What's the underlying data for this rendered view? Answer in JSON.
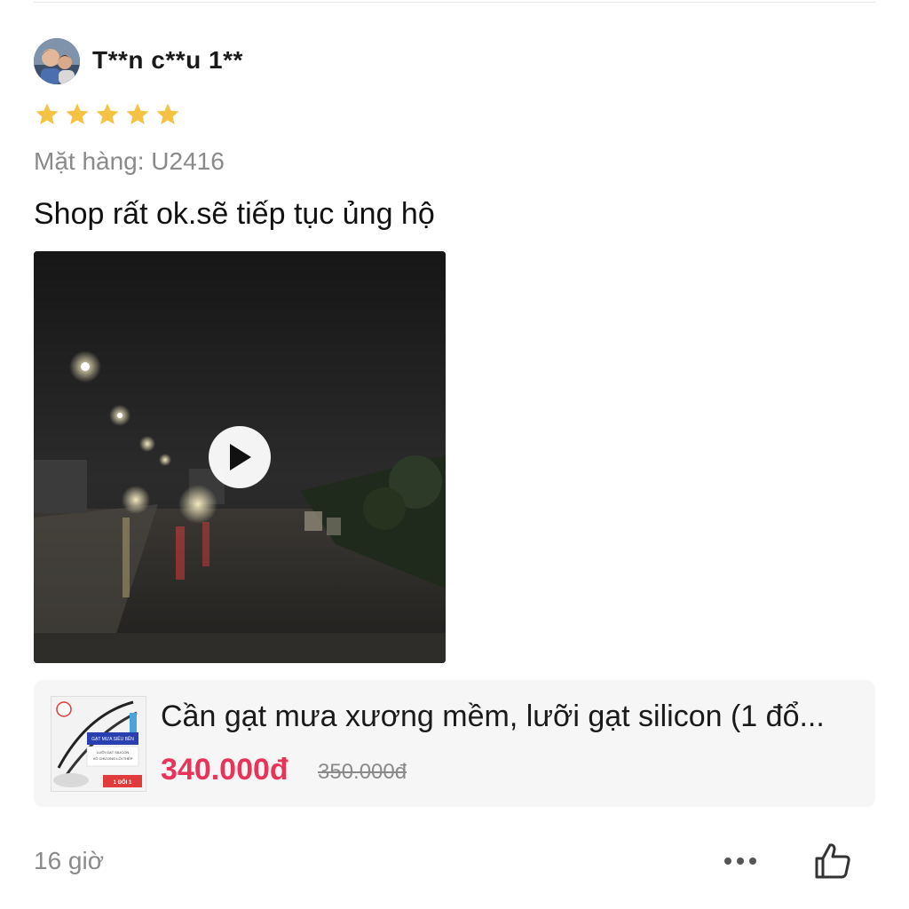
{
  "review": {
    "username": "T**n c**u 1**",
    "rating": 5,
    "variant_label": "Mặt hàng: U2416",
    "comment": "Shop rất ok.sẽ tiếp tục ủng hộ",
    "time": "16 giờ"
  },
  "product": {
    "name": "Cần gạt mưa xương mềm, lưỡi gạt silicon (1 đổ...",
    "price": "340.000đ",
    "original_price": "350.000đ",
    "thumb_text": {
      "banner": "GẠT MƯA SIÊU BỀN",
      "line1": "LƯỠI GẠT SILICON",
      "line2": "VÔ CHƯƠNG LỖI THÉP",
      "badge": "1 ĐỔI 1"
    }
  },
  "colors": {
    "star": "#f6c244",
    "price": "#e8345a",
    "muted": "#8a8a8a"
  },
  "icons": {
    "play": "play-icon",
    "more": "more-dots-icon",
    "like": "thumbs-up-icon"
  }
}
